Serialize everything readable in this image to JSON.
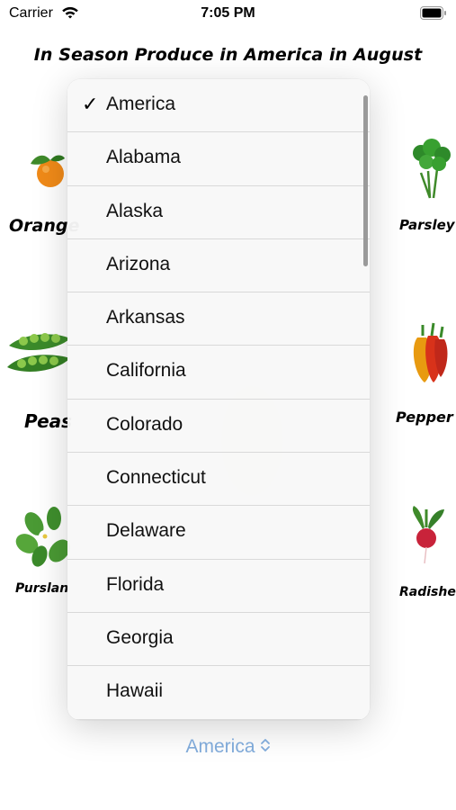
{
  "status_bar": {
    "carrier": "Carrier",
    "time": "7:05 PM"
  },
  "title": "In Season Produce in America in August",
  "produce": {
    "left": [
      "Orange",
      "Peas",
      "Purslan"
    ],
    "right": [
      "Parsley",
      "Pepper",
      "Radishes"
    ]
  },
  "menu": {
    "selected_check": "✓",
    "items": [
      "America",
      "Alabama",
      "Alaska",
      "Arizona",
      "Arkansas",
      "California",
      "Colorado",
      "Connecticut",
      "Delaware",
      "Florida",
      "Georgia",
      "Hawaii"
    ]
  },
  "picker": {
    "label": "America",
    "chevron": "⌃⌄"
  },
  "colors": {
    "accent": "#7fa9d8",
    "menu_bg": "#f8f8f8"
  }
}
